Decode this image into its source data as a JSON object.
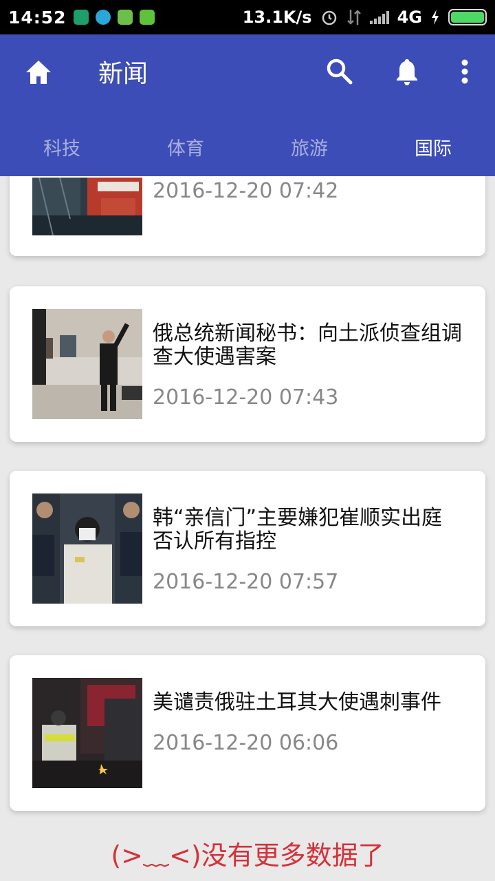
{
  "status_bar": {
    "time": "14:52",
    "net_speed": "13.1K/s",
    "network": "4G"
  },
  "app_bar": {
    "title": "新闻",
    "home_icon": "home-icon",
    "search_icon": "search-icon",
    "bell_icon": "bell-icon",
    "more_icon": "more-vert-icon"
  },
  "tabs": [
    {
      "label": "科技",
      "active": false
    },
    {
      "label": "体育",
      "active": false
    },
    {
      "label": "旅游",
      "active": false
    },
    {
      "label": "国际",
      "active": true
    }
  ],
  "news": [
    {
      "title": "",
      "date": "2016-12-20 07:42"
    },
    {
      "title": "俄总统新闻秘书：向土派侦查组调查大使遇害案",
      "date": "2016-12-20 07:43"
    },
    {
      "title": "韩“亲信门”主要嫌犯崔顺实出庭 否认所有指控",
      "date": "2016-12-20 07:57"
    },
    {
      "title": "美谴责俄驻土耳其大使遇刺事件",
      "date": "2016-12-20 06:06"
    }
  ],
  "footer": {
    "no_more_text": "(>﹏<)没有更多数据了"
  }
}
